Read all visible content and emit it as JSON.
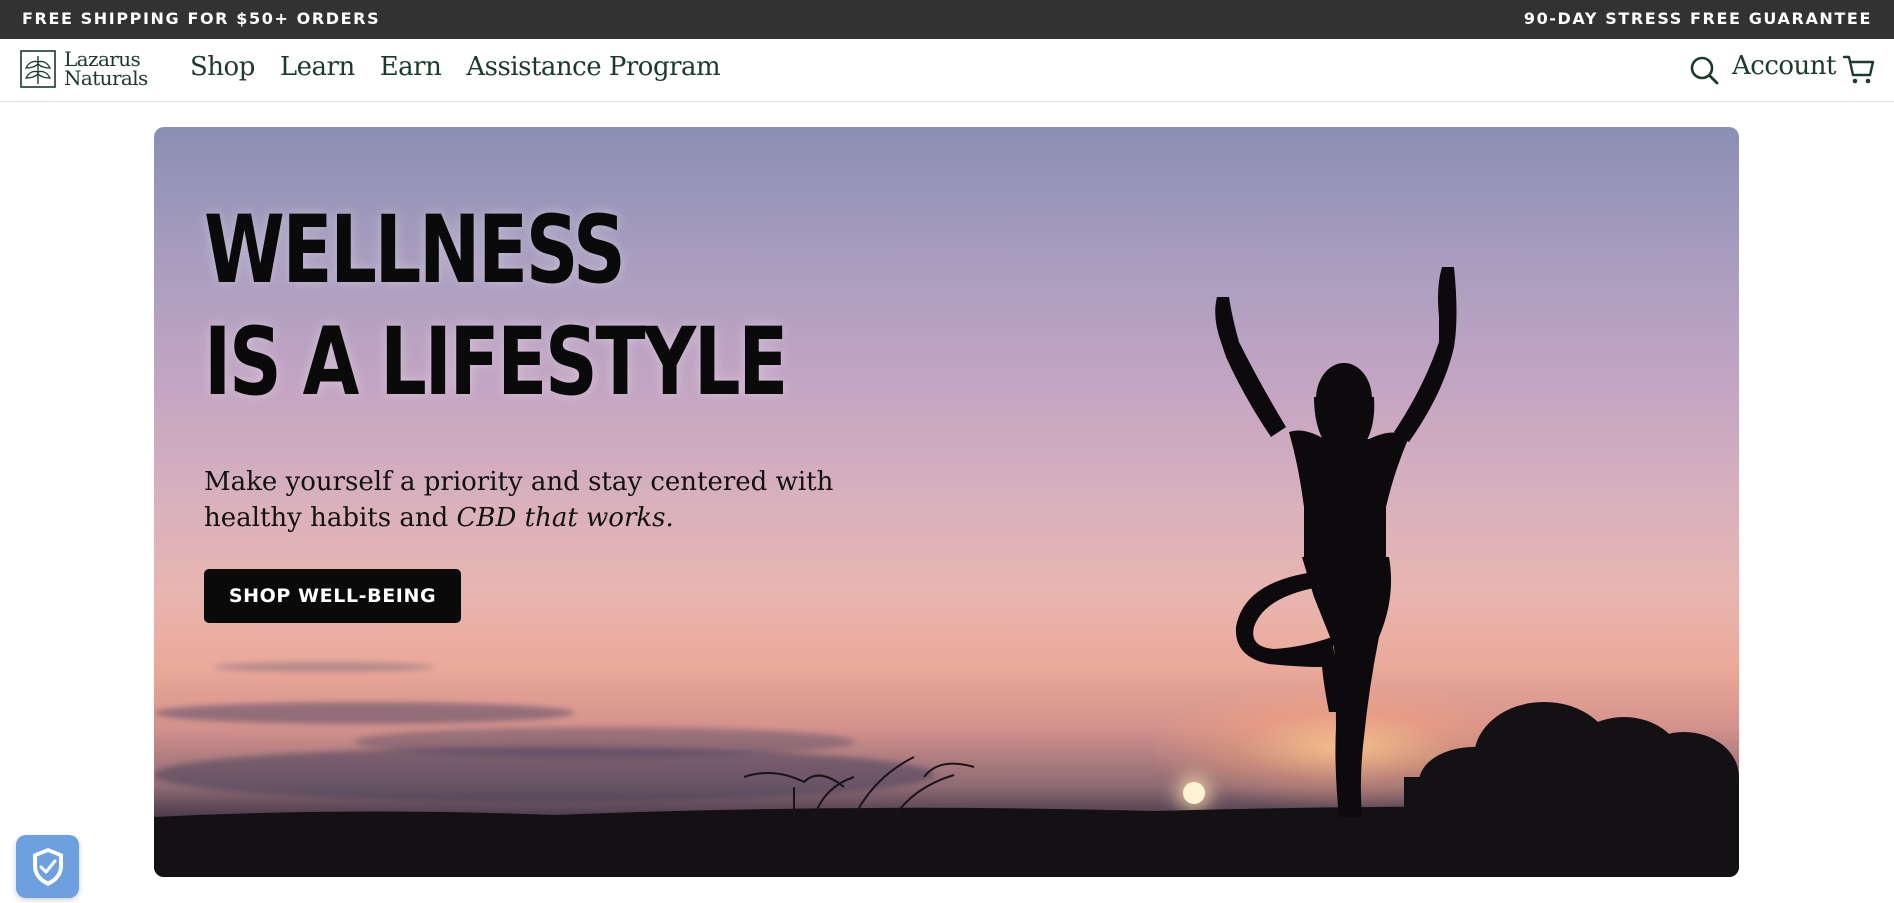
{
  "announcement": {
    "left": "FREE SHIPPING FOR $50+ ORDERS",
    "right": "90-DAY STRESS FREE GUARANTEE"
  },
  "header": {
    "logo": {
      "line1": "Lazarus",
      "line2": "Naturals",
      "icon": "leaf-logo-icon"
    },
    "nav": [
      {
        "label": "Shop"
      },
      {
        "label": "Learn"
      },
      {
        "label": "Earn"
      },
      {
        "label": "Assistance Program"
      }
    ],
    "search_icon": "search-icon",
    "account_label": "Account",
    "cart_icon": "cart-icon"
  },
  "hero": {
    "title_line1": "WELLNESS",
    "title_line2": "IS A LIFESTYLE",
    "subtitle_plain": "Make yourself a priority and stay centered with healthy habits and ",
    "subtitle_italic": "CBD that works.",
    "cta_label": "SHOP WELL-BEING",
    "image_description_icon": "yoga-silhouette-sunset"
  },
  "badge": {
    "icon": "shield-check-icon"
  },
  "colors": {
    "topbar_bg": "#323232",
    "brand_green": "#1b3a2b",
    "cta_bg": "#0a0a0a",
    "badge_bg": "#6ea0e0"
  }
}
